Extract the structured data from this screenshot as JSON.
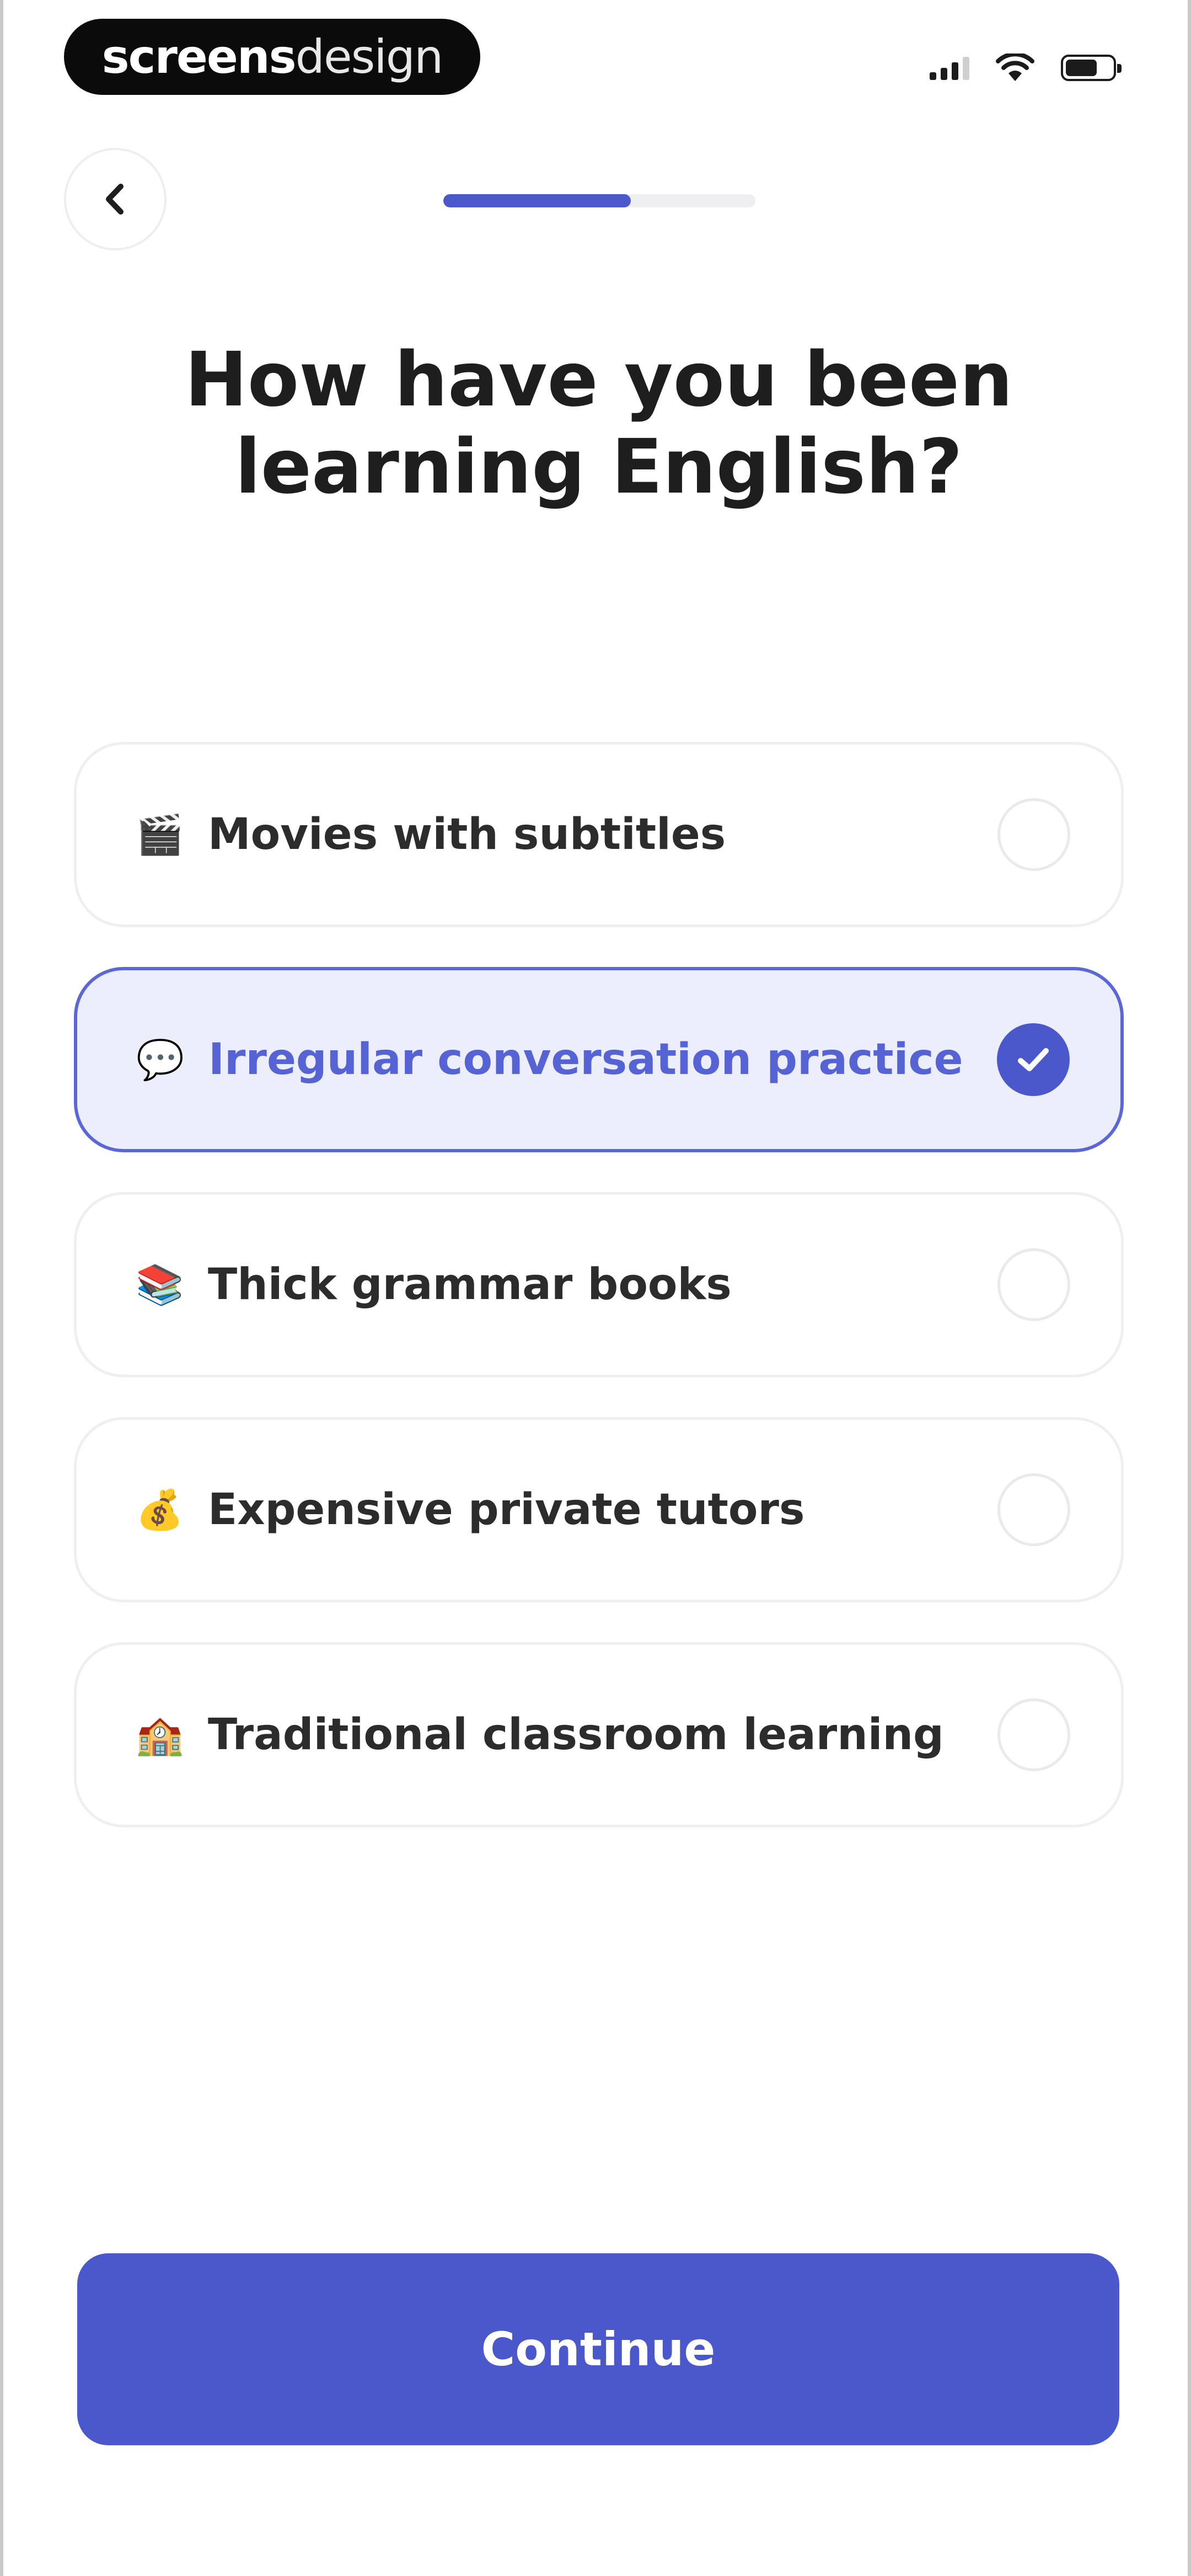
{
  "status_bar": {
    "brand_bold": "screens",
    "brand_light": "design",
    "icons": [
      "cellular-signal-icon",
      "wifi-icon",
      "battery-icon"
    ]
  },
  "header": {
    "back_icon": "chevron-left-icon",
    "progress_percent": 60
  },
  "title": "How have you been learning English?",
  "options": [
    {
      "icon": "🎬",
      "icon_name": "clapperboard-icon",
      "label": "Movies with subtitles",
      "selected": false
    },
    {
      "icon": "💬",
      "icon_name": "speech-bubble-icon",
      "label": "Irregular conversation practice",
      "selected": true
    },
    {
      "icon": "📚",
      "icon_name": "books-icon",
      "label": "Thick grammar books",
      "selected": false
    },
    {
      "icon": "💰",
      "icon_name": "money-bag-icon",
      "label": "Expensive private tutors",
      "selected": false
    },
    {
      "icon": "🏫",
      "icon_name": "school-icon",
      "label": "Traditional classroom learning",
      "selected": false
    }
  ],
  "continue_label": "Continue",
  "colors": {
    "accent": "#4a58cc",
    "selected_bg": "#eceffb",
    "selected_text": "#5563d4"
  }
}
